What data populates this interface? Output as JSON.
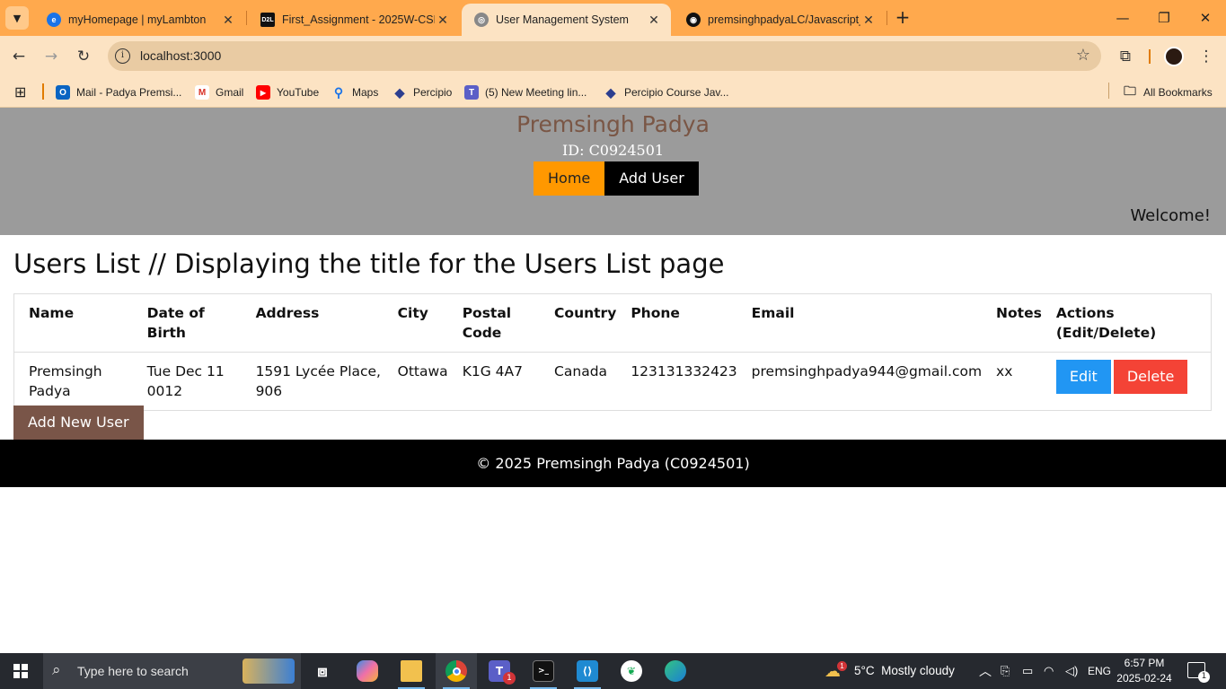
{
  "browser": {
    "tabs": [
      {
        "title": "myHomepage | myLambton"
      },
      {
        "title": "First_Assignment - 2025W-CSD"
      },
      {
        "title": "User Management System"
      },
      {
        "title": "premsinghpadyaLC/Javascript_"
      }
    ],
    "url": "localhost:3000",
    "bookmarks": [
      {
        "label": "Mail - Padya Premsi..."
      },
      {
        "label": "Gmail"
      },
      {
        "label": "YouTube"
      },
      {
        "label": "Maps"
      },
      {
        "label": "Percipio"
      },
      {
        "label": "(5) New Meeting lin..."
      },
      {
        "label": "Percipio Course Jav..."
      }
    ],
    "all_bookmarks": "All Bookmarks"
  },
  "header": {
    "title": "Premsingh Padya",
    "id_text": "ID: C0924501",
    "nav": {
      "home": "Home",
      "add_user": "Add User"
    },
    "welcome": "Welcome!"
  },
  "main": {
    "heading": "Users List // Displaying the title for the Users List page",
    "columns": [
      "Name",
      "Date of Birth",
      "Address",
      "City",
      "Postal Code",
      "Country",
      "Phone",
      "Email",
      "Notes",
      "Actions (Edit/Delete)"
    ],
    "rows": [
      {
        "name": "Premsingh Padya",
        "dob": "Tue Dec 11 0012",
        "address": "1591 Lycée Place, 906",
        "city": "Ottawa",
        "postal": "K1G 4A7",
        "country": "Canada",
        "phone": "123131332423",
        "email": "premsinghpadya944@gmail.com",
        "notes": "xx",
        "edit": "Edit",
        "delete": "Delete"
      }
    ],
    "add_new": "Add New User"
  },
  "footer": {
    "text": "© 2025 Premsingh Padya (C0924501)"
  },
  "taskbar": {
    "search_placeholder": "Type here to search",
    "weather": "5°C  Mostly cloudy",
    "lang": "ENG",
    "time": "6:57 PM",
    "date": "2025-02-24",
    "teams_badge": "1",
    "weather_badge": "1",
    "notif_count": "1"
  },
  "colors": {
    "tabstrip": "#ffa94d",
    "header_bg": "#9b9b9b",
    "title": "#7a5645",
    "home_btn": "#ff9800",
    "edit_btn": "#2196f3",
    "delete_btn": "#f44336",
    "add_new_btn": "#795548"
  }
}
